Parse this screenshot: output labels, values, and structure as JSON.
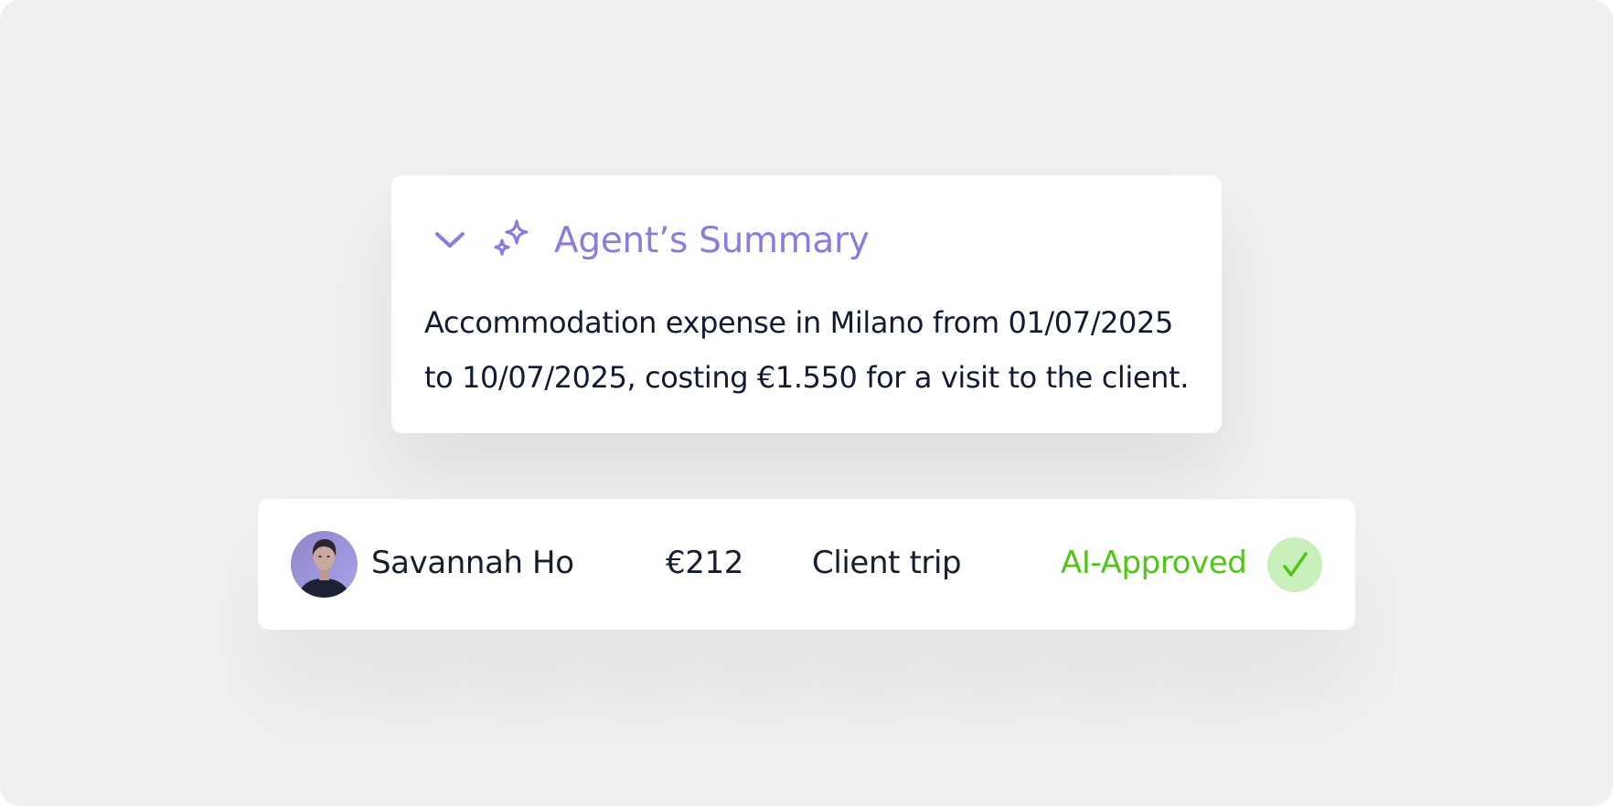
{
  "summary": {
    "title": "Agent’s Summary",
    "body": "Accommodation expense in Milano from 01/07/2025 to 10/07/2025, costing €1.550 for a visit to the client.",
    "chevron_icon": "chevron-down-icon",
    "sparkle_icon": "sparkle-icon",
    "accent_color": "#8a7de0"
  },
  "expense": {
    "employee": "Savannah Ho",
    "amount": "€212",
    "purpose": "Client trip",
    "status": "AI-Approved",
    "status_color": "#52c41a",
    "status_icon": "checkmark-icon"
  }
}
